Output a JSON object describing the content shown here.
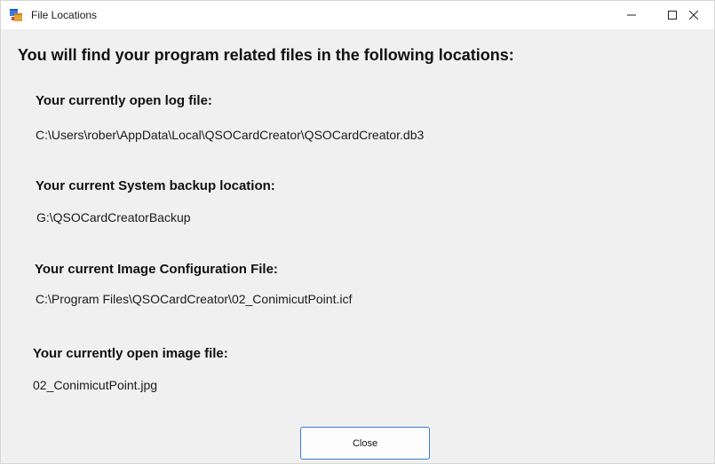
{
  "window": {
    "title": "File Locations",
    "icon": "app-window-icon",
    "controls": {
      "minimize": "minimize-icon",
      "maximize": "maximize-icon",
      "close": "close-icon"
    }
  },
  "main": {
    "headline": "You will find your program related files in the following locations:",
    "sections": [
      {
        "label": "Your currently open log file:",
        "value": "C:\\Users\\rober\\AppData\\Local\\QSOCardCreator\\QSOCardCreator.db3"
      },
      {
        "label": "Your current System  backup location:",
        "value": "G:\\QSOCardCreatorBackup"
      },
      {
        "label": "Your current Image Configuration File:",
        "value": "C:\\Program Files\\QSOCardCreator\\02_ConimicutPoint.icf"
      },
      {
        "label": "Your currently open image file:",
        "value": "02_ConimicutPoint.jpg"
      }
    ]
  },
  "footer": {
    "close_label": "Close"
  },
  "colors": {
    "window_bg": "#f0f0f0",
    "titlebar_bg": "#ffffff",
    "button_border": "#3a7bd5"
  }
}
